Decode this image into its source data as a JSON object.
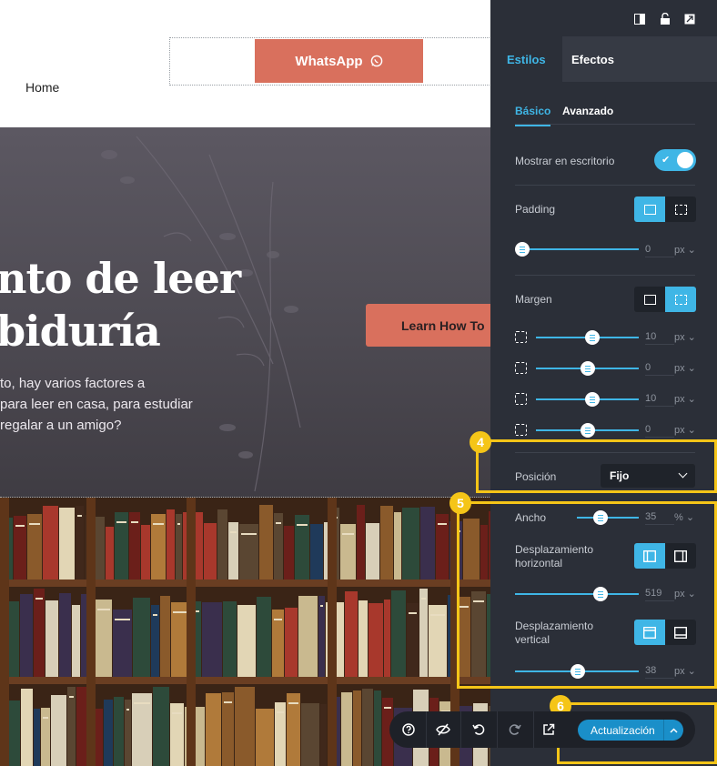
{
  "site": {
    "nav_home": "Home",
    "whatsapp_label": "WhatsApp",
    "hero_title_lines": [
      "nto de leer",
      "biduría"
    ],
    "hero_text_lines": [
      "to, hay varios factores a",
      "para leer en casa, para estudiar",
      "regalar a un amigo?"
    ],
    "learn_button": "Learn How To"
  },
  "panel": {
    "tabs": [
      "Estilos",
      "Efectos"
    ],
    "subtabs": [
      "Básico",
      "Avanzado"
    ],
    "show_desktop_label": "Mostrar en escritorio",
    "show_desktop_enabled": true,
    "padding_label": "Padding",
    "padding_value": "0",
    "padding_unit": "px",
    "margin_label": "Margen",
    "margins": [
      {
        "side": "top",
        "value": "10",
        "unit": "px",
        "level": 0.55
      },
      {
        "side": "right",
        "value": "0",
        "unit": "px",
        "level": 0.5
      },
      {
        "side": "bottom",
        "value": "10",
        "unit": "px",
        "level": 0.55
      },
      {
        "side": "left",
        "value": "0",
        "unit": "px",
        "level": 0.5
      }
    ],
    "position_label": "Posición",
    "position_value": "Fijo",
    "width_label": "Ancho",
    "width_value": "35",
    "width_unit": "%",
    "h_offset_label_lines": [
      "Desplazamiento",
      "horizontal"
    ],
    "h_offset_value": "519",
    "h_offset_unit": "px",
    "v_offset_label_lines": [
      "Desplazamiento",
      "vertical"
    ],
    "v_offset_value": "38",
    "v_offset_unit": "px",
    "update_button": "Actualización"
  },
  "annotations": {
    "badge_4": "4",
    "badge_5": "5",
    "badge_6": "6"
  },
  "colors": {
    "accent": "#3fb6e6",
    "highlight": "#f5c518",
    "cta": "#d9705d",
    "panel_bg": "#2b2f38"
  }
}
